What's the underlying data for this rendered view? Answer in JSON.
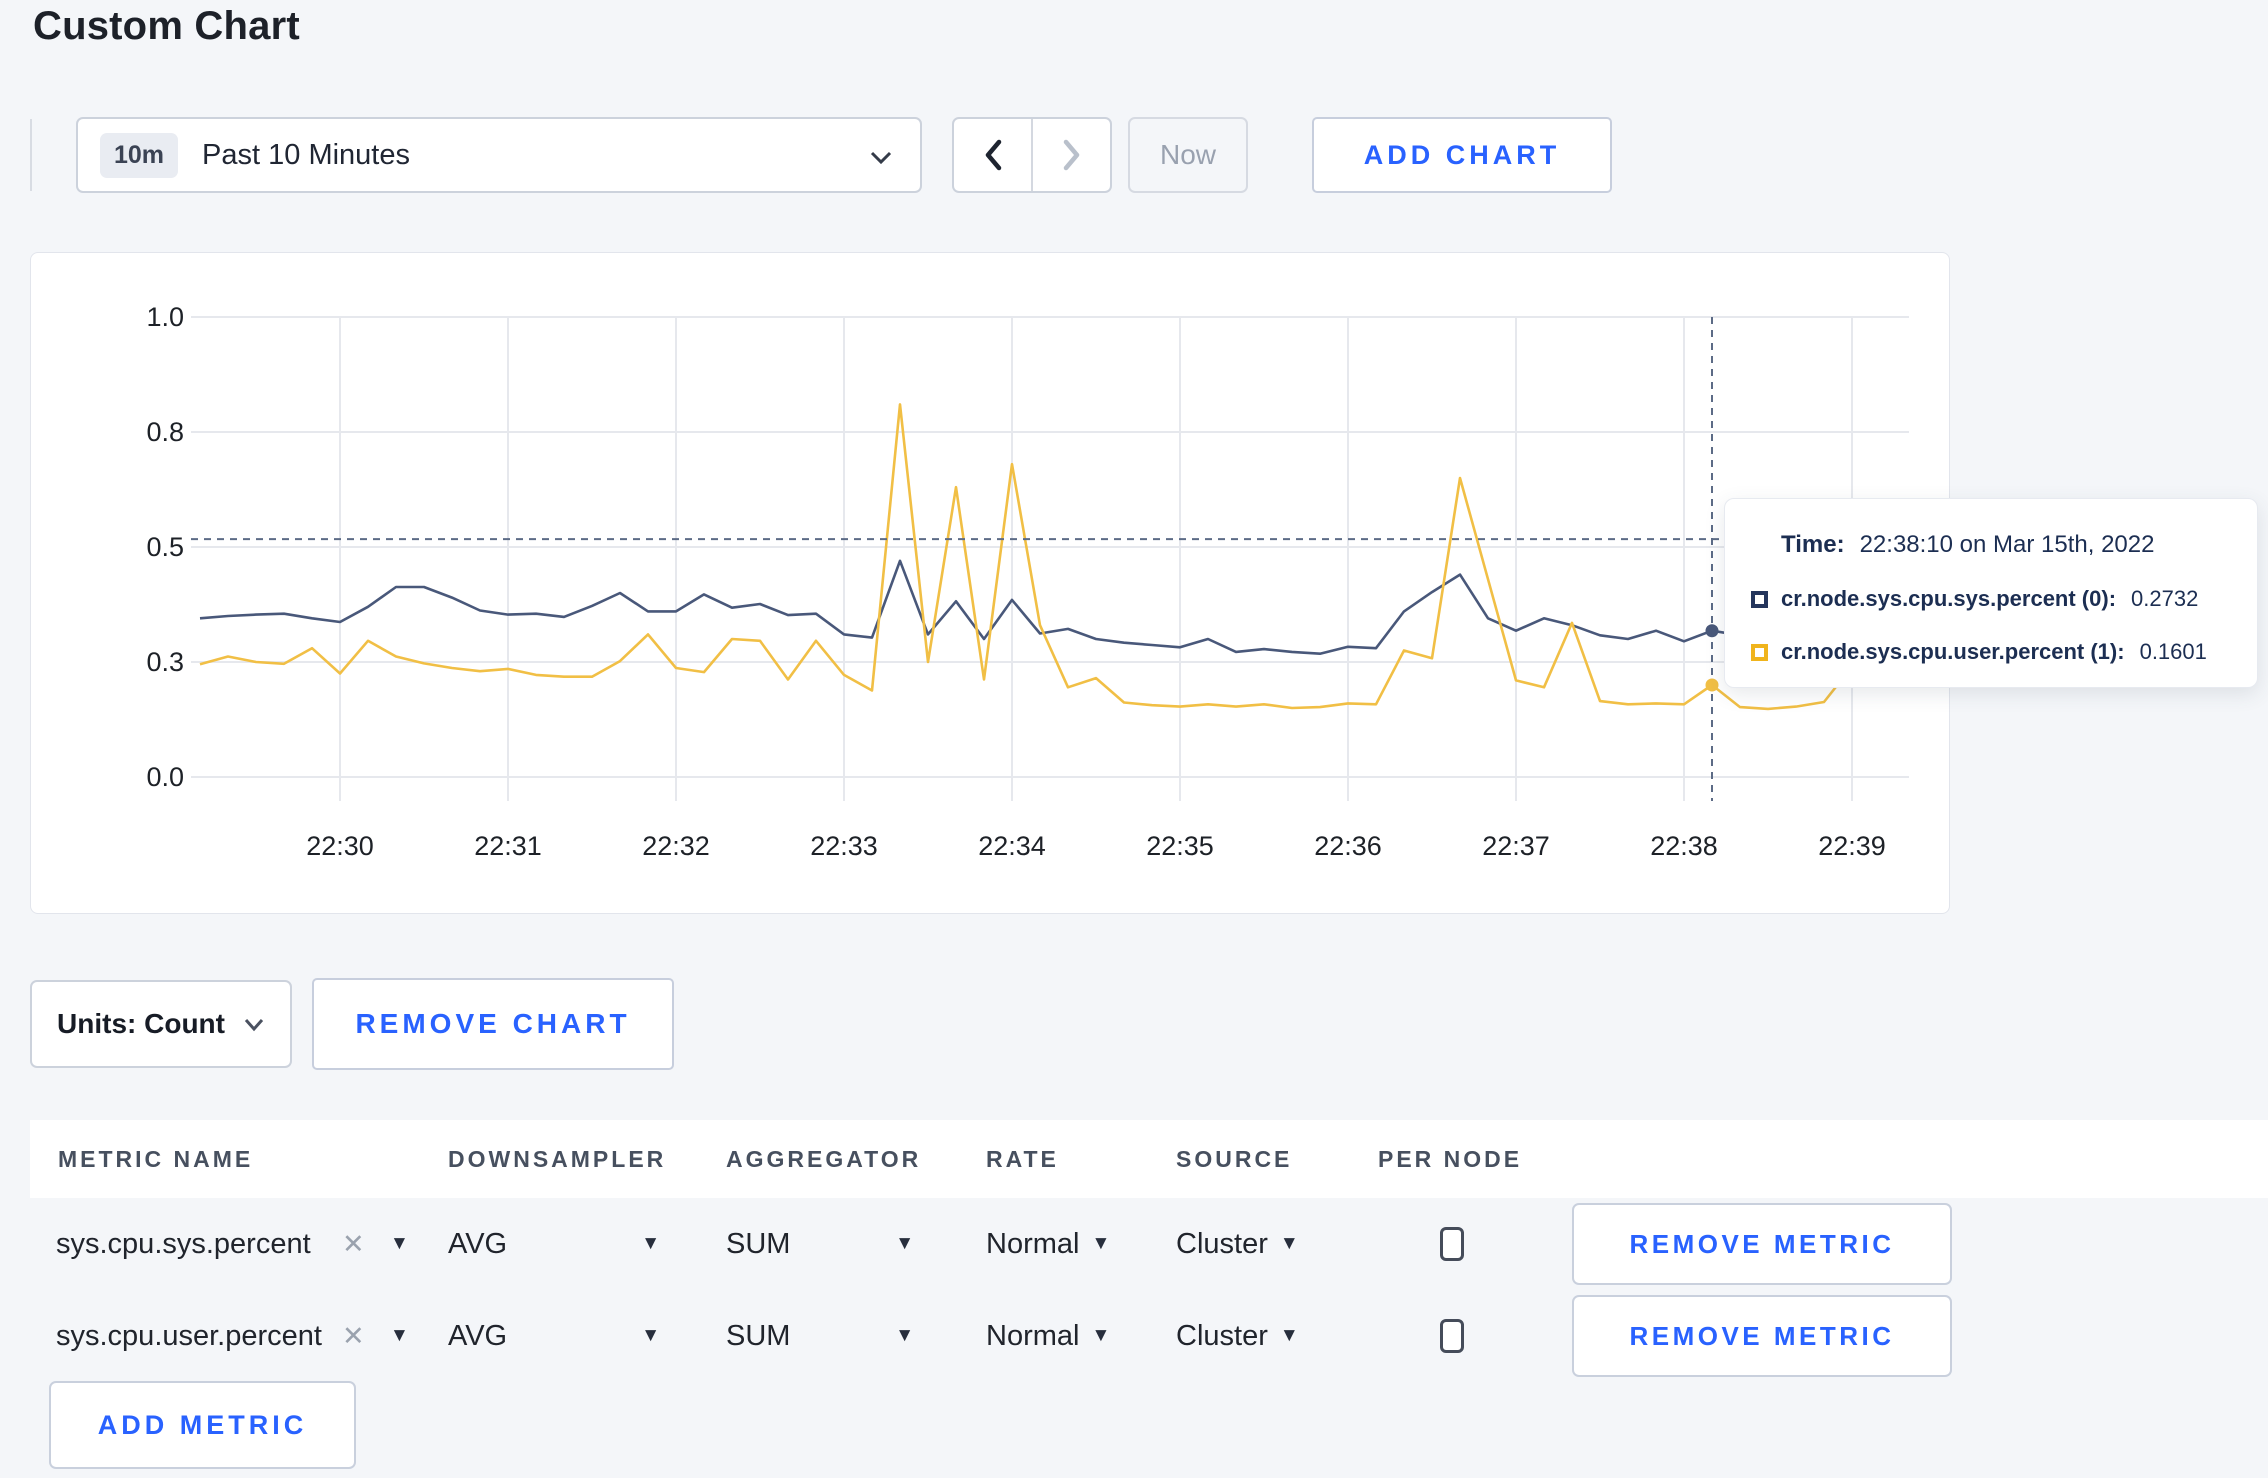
{
  "page": {
    "title": "Custom Chart",
    "background_color": "#f4f6f9",
    "accent_color": "#2962ff"
  },
  "toolbar": {
    "range_badge": "10m",
    "range_label": "Past 10 Minutes",
    "now_label": "Now",
    "add_chart_label": "ADD CHART"
  },
  "chart_data": {
    "type": "line",
    "start_time": "22:29:10",
    "interval_seconds": 10,
    "x_tick_labels": [
      "22:30",
      "22:31",
      "22:32",
      "22:33",
      "22:34",
      "22:35",
      "22:36",
      "22:37",
      "22:38",
      "22:39"
    ],
    "y_tick_labels": [
      "0.0",
      "0.3",
      "0.5",
      "0.8",
      "1.0"
    ],
    "y_tick_values": [
      0,
      0.25,
      0.5,
      0.75,
      1.0
    ],
    "ylim": [
      0,
      1
    ],
    "grid": true,
    "threshold_value": 0.517,
    "crosshair_time": "22:38:10",
    "crosshair_index": 54,
    "series": [
      {
        "name": "cr.node.sys.cpu.sys.percent (0)",
        "color": "#49587a",
        "values": [
          0.345,
          0.35,
          0.353,
          0.355,
          0.345,
          0.337,
          0.37,
          0.413,
          0.413,
          0.39,
          0.362,
          0.353,
          0.355,
          0.348,
          0.372,
          0.4,
          0.36,
          0.36,
          0.397,
          0.368,
          0.376,
          0.352,
          0.355,
          0.31,
          0.303,
          0.47,
          0.31,
          0.382,
          0.3,
          0.385,
          0.312,
          0.322,
          0.3,
          0.292,
          0.287,
          0.282,
          0.3,
          0.272,
          0.278,
          0.272,
          0.268,
          0.283,
          0.28,
          0.36,
          0.402,
          0.44,
          0.345,
          0.318,
          0.345,
          0.33,
          0.308,
          0.3,
          0.318,
          0.295,
          0.318,
          0.308,
          0.3,
          0.288,
          0.29,
          0.3,
          0.302,
          0.3
        ]
      },
      {
        "name": "cr.node.sys.cpu.user.percent (1)",
        "color": "#f1bf45",
        "values": [
          0.245,
          0.262,
          0.25,
          0.246,
          0.28,
          0.225,
          0.296,
          0.262,
          0.247,
          0.237,
          0.23,
          0.235,
          0.222,
          0.218,
          0.218,
          0.252,
          0.31,
          0.237,
          0.228,
          0.3,
          0.296,
          0.212,
          0.296,
          0.222,
          0.188,
          0.81,
          0.25,
          0.63,
          0.212,
          0.68,
          0.33,
          0.195,
          0.215,
          0.162,
          0.156,
          0.153,
          0.158,
          0.153,
          0.158,
          0.15,
          0.152,
          0.16,
          0.158,
          0.275,
          0.258,
          0.65,
          0.43,
          0.21,
          0.195,
          0.335,
          0.165,
          0.158,
          0.16,
          0.158,
          0.2,
          0.152,
          0.148,
          0.153,
          0.163,
          0.24,
          0.245,
          0.205
        ]
      }
    ]
  },
  "tooltip": {
    "time_label": "Time:",
    "time_value": "22:38:10 on Mar 15th, 2022",
    "rows": [
      {
        "label": "cr.node.sys.cpu.sys.percent (0):",
        "value": "0.2732",
        "color": "#24355c"
      },
      {
        "label": "cr.node.sys.cpu.user.percent (1):",
        "value": "0.1601",
        "color": "#f0b41c"
      }
    ]
  },
  "chart_footer": {
    "units_label": "Units: Count",
    "remove_chart_label": "REMOVE CHART"
  },
  "metrics_table": {
    "headers": [
      "METRIC NAME",
      "DOWNSAMPLER",
      "AGGREGATOR",
      "RATE",
      "SOURCE",
      "PER NODE"
    ],
    "rows": [
      {
        "metric": "sys.cpu.sys.percent",
        "downsampler": "AVG",
        "aggregator": "SUM",
        "rate": "Normal",
        "source": "Cluster",
        "per_node": false,
        "remove_label": "REMOVE METRIC"
      },
      {
        "metric": "sys.cpu.user.percent",
        "downsampler": "AVG",
        "aggregator": "SUM",
        "rate": "Normal",
        "source": "Cluster",
        "per_node": false,
        "remove_label": "REMOVE METRIC"
      }
    ],
    "add_metric_label": "ADD METRIC"
  }
}
